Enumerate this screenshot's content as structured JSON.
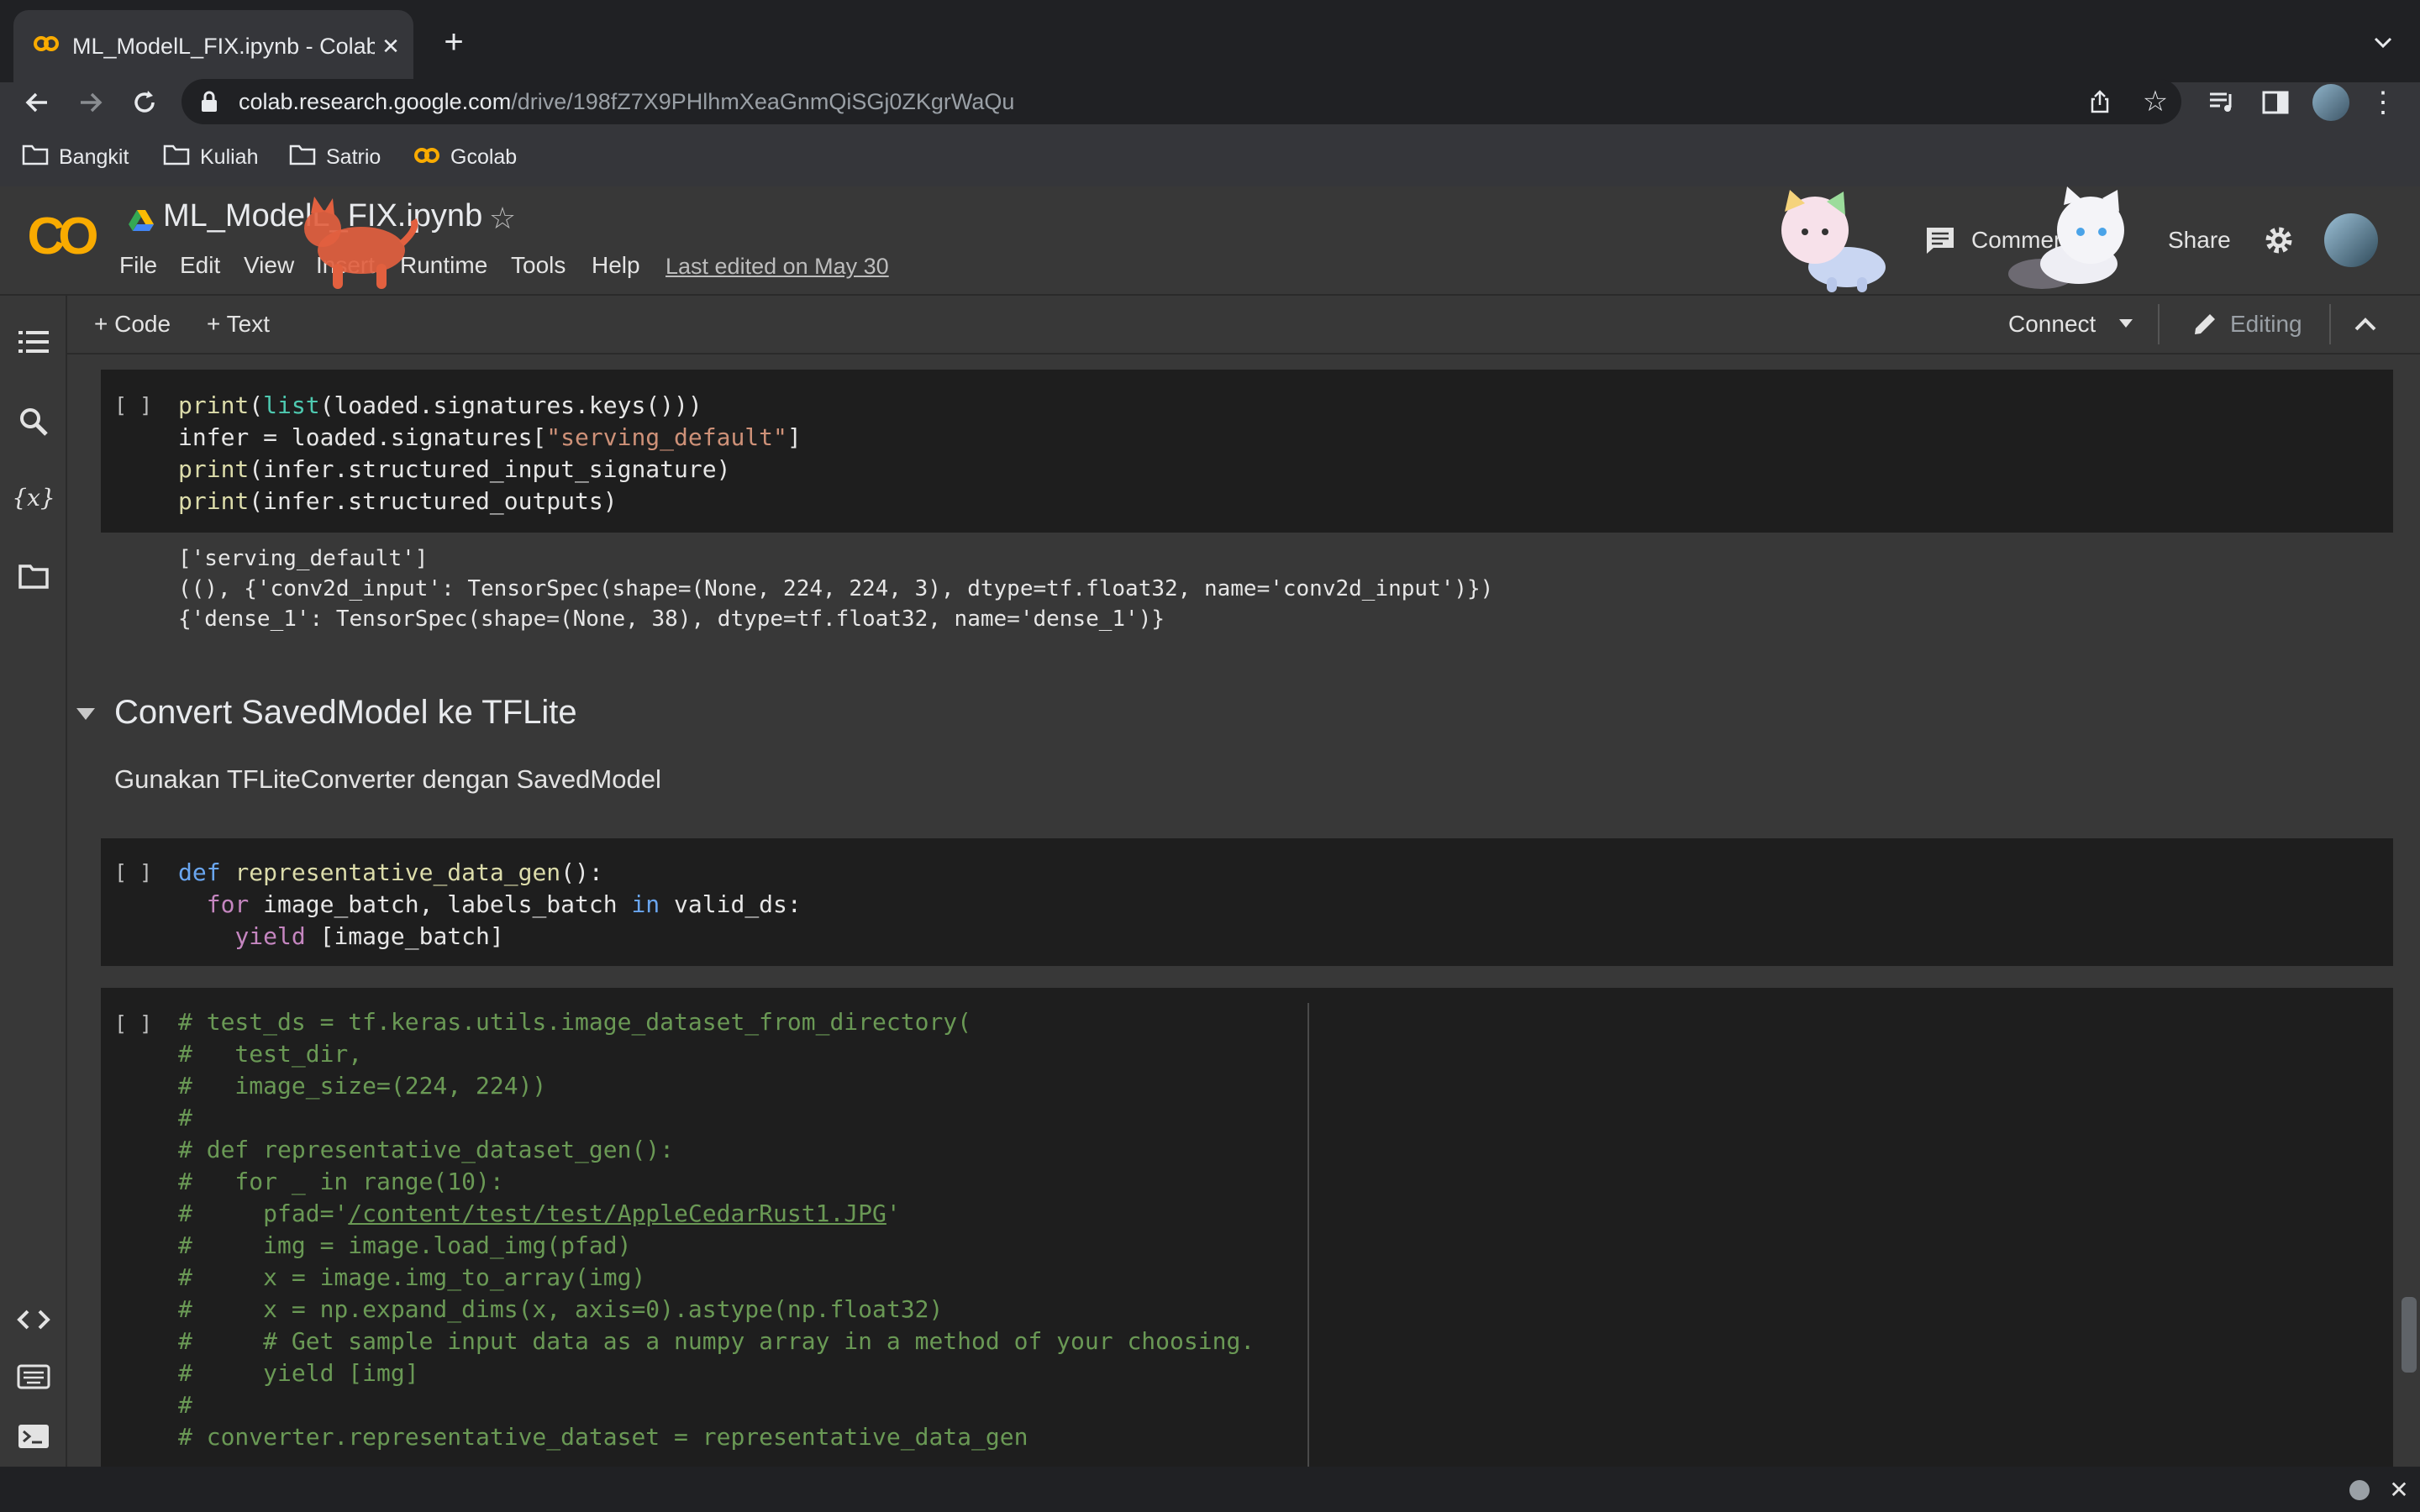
{
  "browser": {
    "tab_title": "ML_ModelL_FIX.ipynb - Colab",
    "url_host": "colab.research.google.com",
    "url_path": "/drive/198fZ7X9PHlhmXeaGnmQiSGj0ZKgrWaQu",
    "bookmarks": [
      "Bangkit",
      "Kuliah",
      "Satrio",
      "Gcolab"
    ]
  },
  "colab": {
    "logo": "CO",
    "notebook_title": "ML_ModelL_FIX.ipynb",
    "menu": [
      "File",
      "Edit",
      "View",
      "Insert",
      "Runtime",
      "Tools",
      "Help"
    ],
    "last_edited": "Last edited on May 30",
    "comment_label": "Comment",
    "share_label": "Share"
  },
  "toolbar": {
    "add_code": "+ Code",
    "add_text": "+ Text",
    "connect": "Connect",
    "editing": "Editing"
  },
  "cells": {
    "run_marker": "[ ]",
    "section_title": "Convert SavedModel ke TFLite",
    "section_text": "Gunakan TFLiteConverter dengan SavedModel"
  },
  "outputs": [
    "['serving_default']",
    "((), {'conv2d_input': TensorSpec(shape=(None, 224, 224, 3), dtype=tf.float32, name='conv2d_input')})",
    "{'dense_1': TensorSpec(shape=(None, 38), dtype=tf.float32, name='dense_1')}"
  ],
  "comment_code": [
    "# test_ds = tf.keras.utils.image_dataset_from_directory(",
    "#   test_dir,",
    "#   image_size=(224, 224))",
    "#",
    "# def representative_dataset_gen():",
    "#   for _ in range(10):",
    "#     pfad='",
    "/content/test/test/AppleCedarRust1.JPG",
    "'",
    "#     img = image.load_img(pfad)",
    "#     x = image.img_to_array(img)",
    "#     x = np.expand_dims(x, axis=0).astype(np.float32)",
    "#     # Get sample input data as a numpy array in a method of your choosing.",
    "#     yield [img]",
    "#",
    "# converter.representative_dataset = representative_data_gen"
  ],
  "icons": [
    "colab-favicon",
    "close-icon",
    "new-tab-icon",
    "back-icon",
    "forward-icon",
    "reload-icon",
    "lock-icon",
    "share-page-icon",
    "star-icon",
    "media-icon",
    "sidepanel-icon",
    "folder-icon",
    "drive-icon",
    "comment-icon",
    "settings-icon",
    "toc-icon",
    "search-icon",
    "variables-icon",
    "files-icon",
    "code-snippets-icon",
    "command-palette-icon",
    "terminal-icon",
    "pencil-icon",
    "chevron-up-icon",
    "collapse-caret-icon"
  ]
}
